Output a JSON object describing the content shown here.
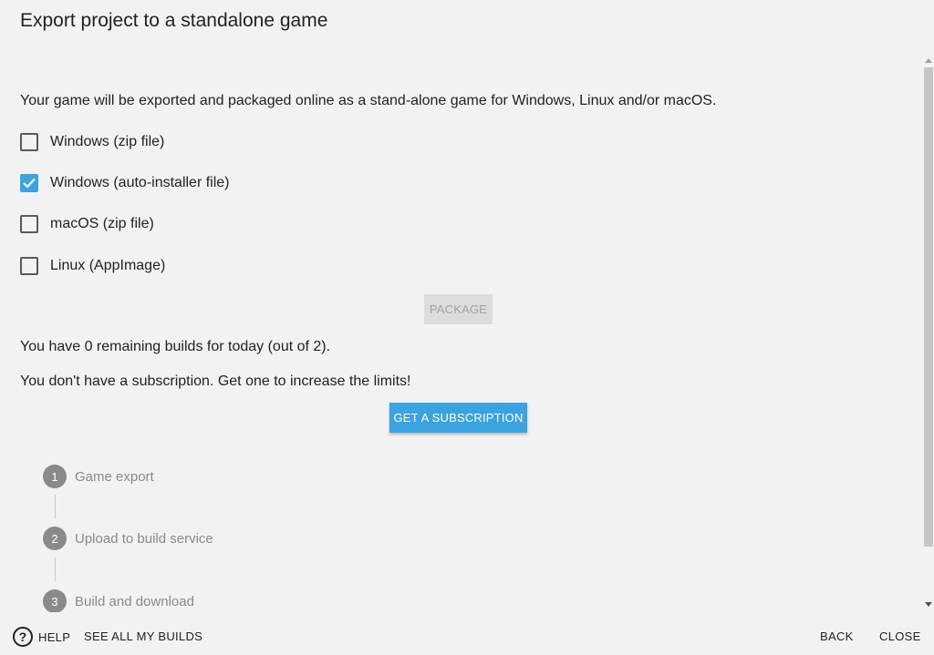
{
  "dialog": {
    "title": "Export project to a standalone game",
    "description": "Your game will be exported and packaged online as a stand-alone game for Windows, Linux and/or macOS."
  },
  "targets": [
    {
      "label": "Windows (zip file)",
      "checked": false
    },
    {
      "label": "Windows (auto-installer file)",
      "checked": true
    },
    {
      "label": "macOS (zip file)",
      "checked": false
    },
    {
      "label": "Linux (AppImage)",
      "checked": false
    }
  ],
  "package_button": {
    "label": "PACKAGE",
    "disabled": true
  },
  "builds_info": "You have 0 remaining builds for today (out of 2).",
  "subscription_info": "You don't have a subscription. Get one to increase the limits!",
  "subscription_button": {
    "label": "GET A SUBSCRIPTION"
  },
  "steps": [
    {
      "number": "1",
      "label": "Game export"
    },
    {
      "number": "2",
      "label": "Upload to build service"
    },
    {
      "number": "3",
      "label": "Build and download"
    }
  ],
  "footer": {
    "help_label": "HELP",
    "see_builds_label": "SEE ALL MY BUILDS",
    "back_label": "BACK",
    "close_label": "CLOSE"
  },
  "colors": {
    "accent": "#3aa3e0",
    "background": "#f2f2f2",
    "step_gray": "#8a8a8a"
  }
}
